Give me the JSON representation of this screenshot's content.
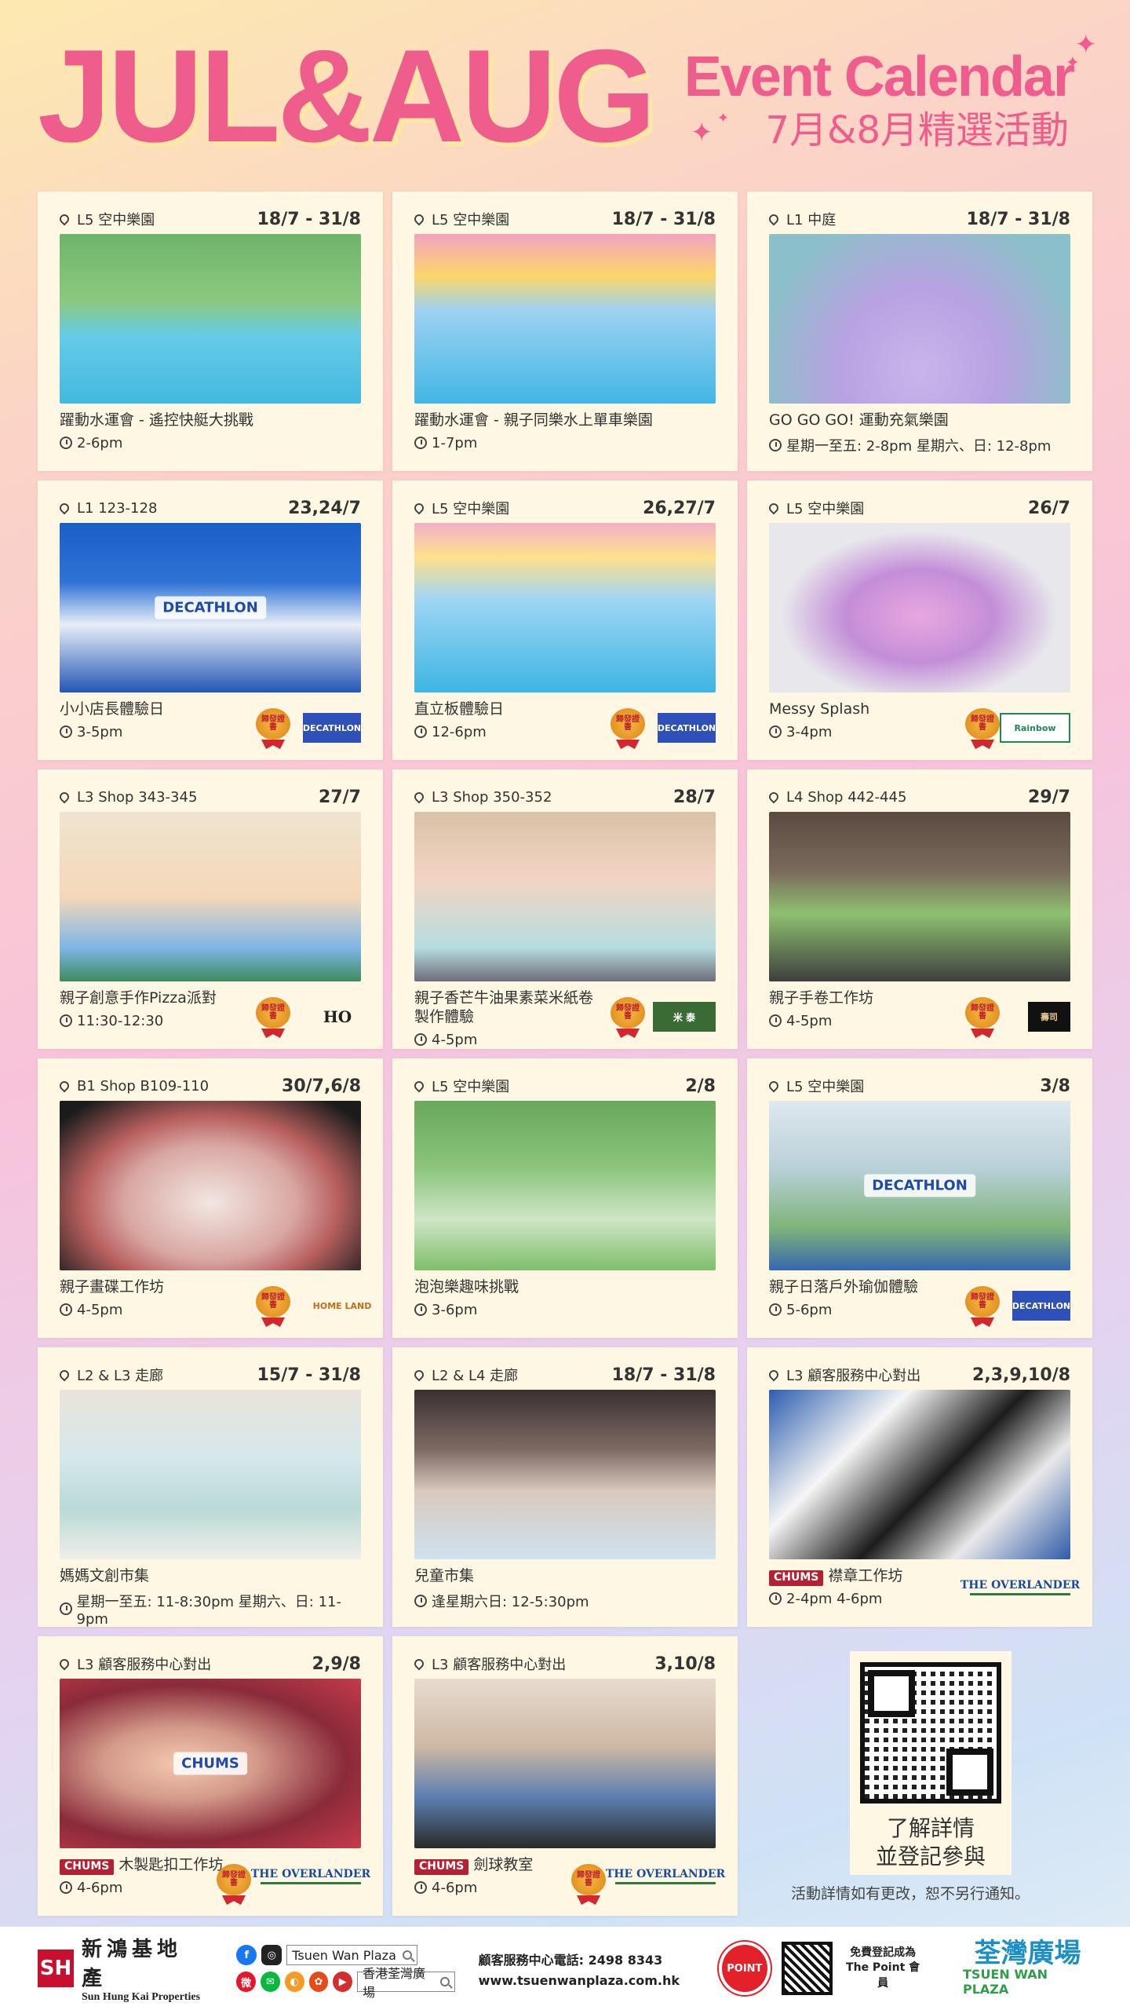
{
  "header": {
    "big_title": "JUL&AUG",
    "event_calendar": "Event Calendar",
    "subtitle": "7月&8月精選活動",
    "accent_color": "#ef5d8c"
  },
  "gift_label": "歸發證書",
  "events": [
    {
      "location": "L5 空中樂園",
      "date": "18/7 - 31/8",
      "title": "躍動水運會 - 遙控快艇大挑戰",
      "time": "2-6pm",
      "photo": "pool",
      "gift": false,
      "brand": ""
    },
    {
      "location": "L5 空中樂園",
      "date": "18/7 - 31/8",
      "title": "躍動水運會 - 親子同樂水上單車樂園",
      "time": "1-7pm",
      "photo": "pool2",
      "gift": false,
      "brand": ""
    },
    {
      "location": "L1 中庭",
      "date": "18/7 - 31/8",
      "title": "GO GO GO! 運動充氣樂園",
      "time": "星期一至五: 2-8pm 星期六、日: 12-8pm",
      "photo": "balls",
      "gift": false,
      "brand": ""
    },
    {
      "location": "L1 123-128",
      "date": "23,24/7",
      "title": "小小店長體驗日",
      "time": "3-5pm",
      "photo": "store",
      "photo_text": "DECATHLON",
      "gift": true,
      "brand": "DECATHLON"
    },
    {
      "location": "L5 空中樂園",
      "date": "26,27/7",
      "title": "直立板體驗日",
      "time": "12-6pm",
      "photo": "sup",
      "gift": true,
      "brand": "DECATHLON"
    },
    {
      "location": "L5 空中樂園",
      "date": "26/7",
      "title": "Messy Splash",
      "time": "3-4pm",
      "photo": "cap",
      "gift": true,
      "brand": "Rainbow"
    },
    {
      "location": "L3 Shop 343-345",
      "date": "27/7",
      "title": "親子創意手作Pizza派對",
      "time": "11:30-12:30",
      "photo": "pizza",
      "gift": true,
      "brand": "HO"
    },
    {
      "location": "L3 Shop 350-352",
      "date": "28/7",
      "title": "親子香芒牛油果素菜米紙卷製作體驗",
      "time": "4-5pm",
      "photo": "roll",
      "gift": true,
      "brand": "米 泰"
    },
    {
      "location": "L4 Shop 442-445",
      "date": "29/7",
      "title": "親子手卷工作坊",
      "time": "4-5pm",
      "photo": "hand",
      "gift": true,
      "brand": "壽司"
    },
    {
      "location": "B1 Shop B109-110",
      "date": "30/7,6/8",
      "title": "親子畫碟工作坊",
      "time": "4-5pm",
      "photo": "cake",
      "gift": true,
      "brand": "HOME LAND"
    },
    {
      "location": "L5 空中樂園",
      "date": "2/8",
      "title": "泡泡樂趣味挑戰",
      "time": "3-6pm",
      "photo": "hoop",
      "gift": false,
      "brand": ""
    },
    {
      "location": "L5 空中樂園",
      "date": "3/8",
      "title": "親子日落戶外瑜伽體驗",
      "time": "5-6pm",
      "photo": "yoga",
      "photo_text": "DECATHLON",
      "gift": true,
      "brand": "DECATHLON"
    },
    {
      "location": "L2 & L3 走廊",
      "date": "15/7 - 31/8",
      "title": "媽媽文創市集",
      "time": "星期一至五: 11-8:30pm 星期六、日: 11-9pm",
      "photo": "market",
      "gift": false,
      "brand": ""
    },
    {
      "location": "L2 & L4 走廊",
      "date": "18/7 - 31/8",
      "title": "兒童市集",
      "time": "逢星期六日: 12-5:30pm",
      "photo": "kids",
      "gift": false,
      "brand": ""
    },
    {
      "location": "L3 顧客服務中心對出",
      "date": "2,3,9,10/8",
      "chums": "CHUMS",
      "title": "襟章工作坊",
      "time": "2-4pm 4-6pm",
      "photo": "badge",
      "gift": false,
      "brand": "THE OVERLANDER"
    },
    {
      "location": "L3 顧客服務中心對出",
      "date": "2,9/8",
      "chums": "CHUMS",
      "title": "木製匙扣工作坊",
      "time": "4-6pm",
      "photo": "chums",
      "photo_text": "CHUMS",
      "gift": true,
      "brand": "THE OVERLANDER"
    },
    {
      "location": "L3 顧客服務中心對出",
      "date": "3,10/8",
      "chums": "CHUMS",
      "title": "劍球教室",
      "time": "4-6pm",
      "photo": "chair",
      "gift": true,
      "brand": "THE OVERLANDER"
    }
  ],
  "qr": {
    "text_line1": "了解詳情",
    "text_line2": "並登記參與"
  },
  "notice": "活動詳情如有更改，恕不另行通知。",
  "footer": {
    "shkp_logo": "SH",
    "shkp_zh": "新鴻基地產",
    "shkp_en": "Sun Hung Kai Properties",
    "social_search_en": "Tsuen Wan Plaza",
    "social_search_zh": "香港荃灣廣場",
    "hotline": "顧客服務中心電話: 2498 8343",
    "website": "www.tsuenwanplaza.com.hk",
    "point_logo": "POINT",
    "member_line1": "免費登記成為",
    "member_line2": "The Point 會員",
    "twp_zh": "荃灣廣場",
    "twp_en": "TSUEN WAN PLAZA"
  }
}
